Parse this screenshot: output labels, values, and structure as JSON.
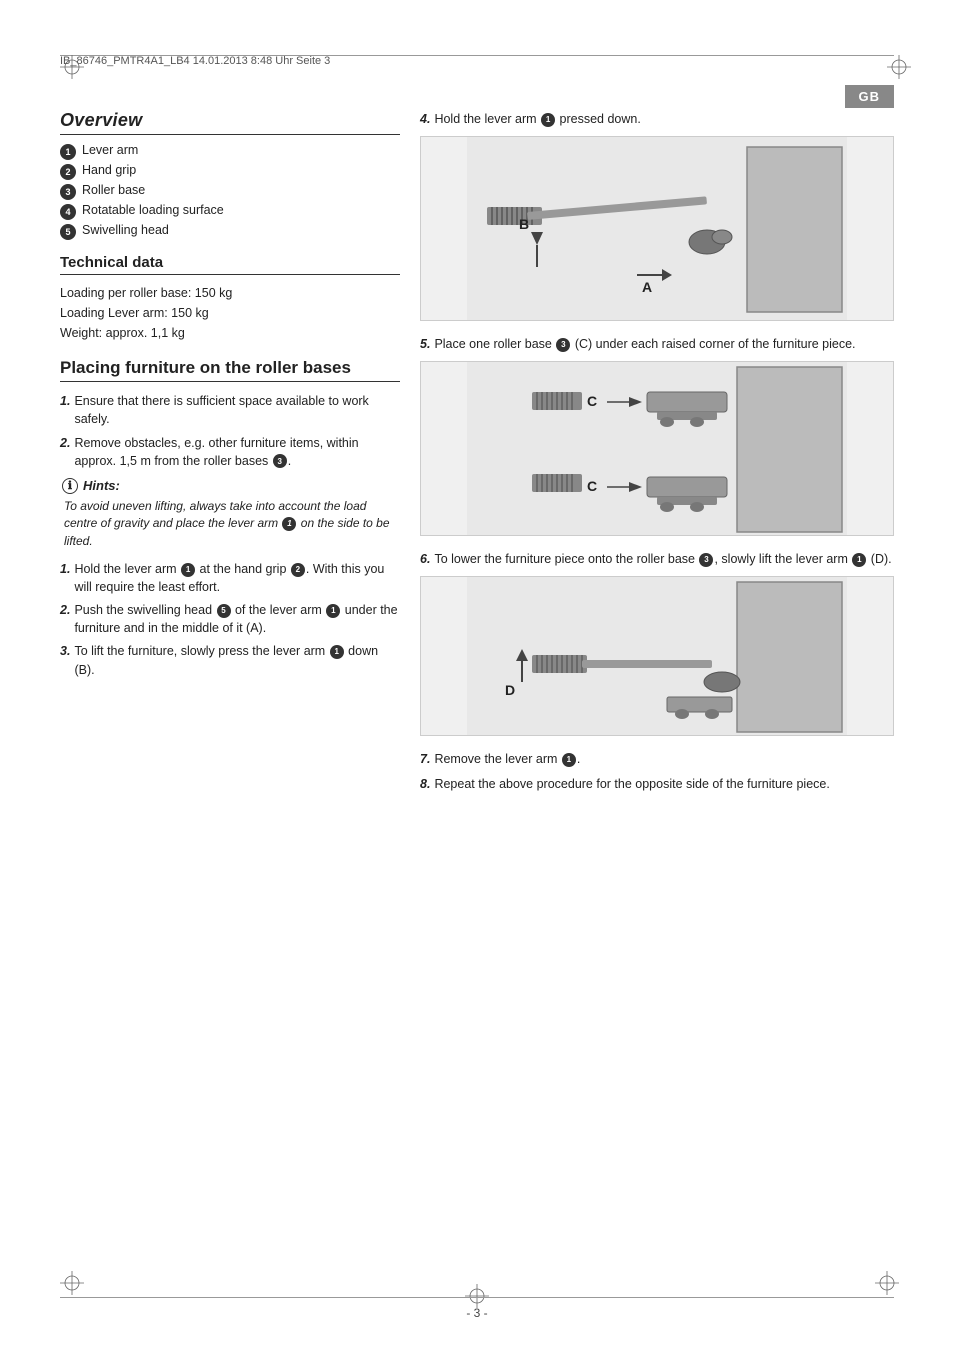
{
  "header": {
    "meta": "IB_86746_PMTR4A1_LB4   14.01.2013   8:48 Uhr   Seite 3",
    "badge": "GB"
  },
  "overview": {
    "title": "Overview",
    "items": [
      {
        "num": "1",
        "label": "Lever arm"
      },
      {
        "num": "2",
        "label": "Hand grip"
      },
      {
        "num": "3",
        "label": "Roller base"
      },
      {
        "num": "4",
        "label": "Rotatable loading surface"
      },
      {
        "num": "5",
        "label": "Swivelling head"
      }
    ]
  },
  "technical_data": {
    "title": "Technical data",
    "lines": [
      "Loading per roller base: 150 kg",
      "Loading Lever arm: 150 kg",
      "Weight: approx. 1,1 kg"
    ]
  },
  "placing": {
    "title": "Placing furniture on the roller bases",
    "steps_pre": [
      {
        "num": "1.",
        "text": "Ensure that there is sufficient space available to work safely."
      },
      {
        "num": "2.",
        "text": "Remove obstacles, e.g. other furniture items, within approx. 1,5 m from the roller bases"
      }
    ],
    "hints_title": "Hints:",
    "hints_text": "To avoid uneven lifting, always take into account the load centre of gravity and place the lever arm on the side to be lifted.",
    "steps_main": [
      {
        "num": "1.",
        "text": "Hold the lever arm at the hand grip . With this you will require the least effort.",
        "badge_positions": [
          1,
          2
        ]
      },
      {
        "num": "2.",
        "text": "Push the swivelling head of the lever arm under the furniture and in the middle of it (A).",
        "badge_positions": [
          5,
          1
        ]
      },
      {
        "num": "3.",
        "text": "To lift the furniture, slowly press the lever arm down (B).",
        "badge_positions": [
          1
        ]
      }
    ]
  },
  "right_column": {
    "step4": {
      "num": "4.",
      "text": "Hold the lever arm pressed down."
    },
    "step5": {
      "num": "5.",
      "text": "Place one roller base (C) under each raised corner of the furniture piece."
    },
    "step6": {
      "num": "6.",
      "text": "To lower the furniture piece onto the roller base , slowly lift the lever arm (D)."
    },
    "step7": {
      "num": "7.",
      "text": "Remove the lever arm ."
    },
    "step8": {
      "num": "8.",
      "text": "Repeat the above procedure for the opposite side of the furniture piece."
    }
  },
  "footer": {
    "page": "- 3 -"
  }
}
